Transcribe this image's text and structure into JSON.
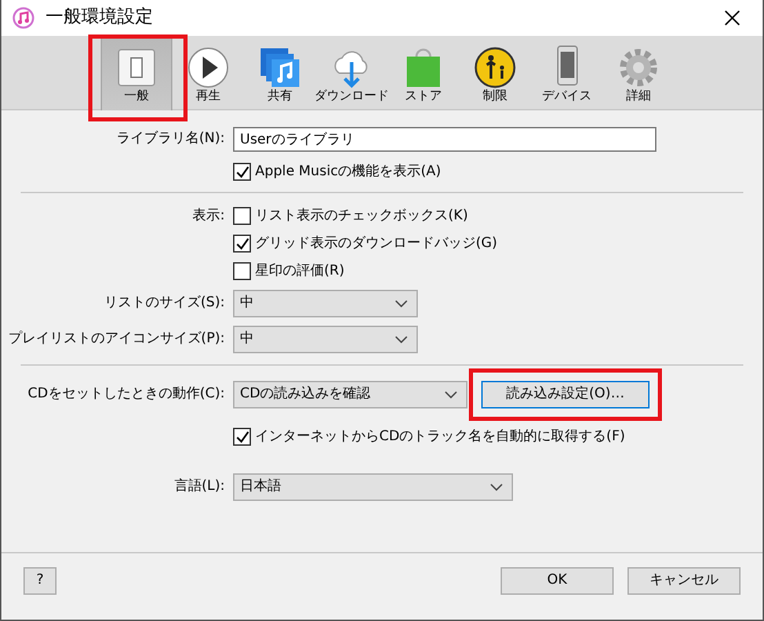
{
  "window": {
    "title": "一般環境設定"
  },
  "toolbar": [
    {
      "label": "一般",
      "kind": "switch",
      "selected": true,
      "highlighted": true
    },
    {
      "label": "再生",
      "kind": "play",
      "selected": false,
      "highlighted": false
    },
    {
      "label": "共有",
      "kind": "music",
      "selected": false,
      "highlighted": false
    },
    {
      "label": "ダウンロード",
      "kind": "download",
      "selected": false,
      "highlighted": false
    },
    {
      "label": "ストア",
      "kind": "bag",
      "selected": false,
      "highlighted": false
    },
    {
      "label": "制限",
      "kind": "parental",
      "selected": false,
      "highlighted": false
    },
    {
      "label": "デバイス",
      "kind": "phone",
      "selected": false,
      "highlighted": false
    },
    {
      "label": "詳細",
      "kind": "gear",
      "selected": false,
      "highlighted": false
    }
  ],
  "library": {
    "label": "ライブラリ名(N):",
    "value": "Userのライブラリ",
    "apple_music": {
      "label": "Apple Musicの機能を表示(A)",
      "checked": true
    }
  },
  "display": {
    "label": "表示:",
    "options": [
      {
        "label": "リスト表示のチェックボックス(K)",
        "checked": false
      },
      {
        "label": "グリッド表示のダウンロードバッジ(G)",
        "checked": true
      },
      {
        "label": "星印の評価(R)",
        "checked": false
      }
    ]
  },
  "list_size": {
    "label": "リストのサイズ(S):",
    "value": "中"
  },
  "playlist_icon_size": {
    "label": "プレイリストのアイコンサイズ(P):",
    "value": "中"
  },
  "cd": {
    "label": "CDをセットしたときの動作(C):",
    "value": "CDの読み込みを確認",
    "button": {
      "label": "読み込み設定(O)…",
      "highlighted": true
    },
    "lookup": {
      "label": "インターネットからCDのトラック名を自動的に取得する(F)",
      "checked": true
    }
  },
  "language": {
    "label": "言語(L):",
    "value": "日本語"
  },
  "footer": {
    "help": "?",
    "ok": "OK",
    "cancel": "キャンセル"
  }
}
